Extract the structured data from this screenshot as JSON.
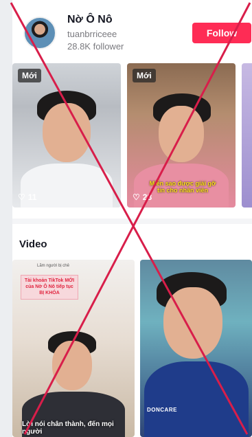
{
  "profile": {
    "name": "Nờ Ô Nô",
    "handle": "tuanbrriceee",
    "followers": "28.8K follower",
    "follow_label": "Follow"
  },
  "tiles": [
    {
      "badge": "Mới",
      "likes": "11"
    },
    {
      "badge": "Mới",
      "likes": "28",
      "caption": "Miễn sao được giải gỡ tín cho nhân viên"
    }
  ],
  "video_section": {
    "title": "Video",
    "v1": {
      "note": "Lãm người bị chê",
      "overlay": "Tài khoản TikTok MỚI của Nờ Ô Nô tiếp tục BỊ KHÓA",
      "caption": "Lời nói chân thành, đến mọi người"
    },
    "v2": {
      "brand": "DONCARE"
    }
  },
  "colors": {
    "accent": "#fe2c55",
    "cross": "#d81e4a"
  }
}
